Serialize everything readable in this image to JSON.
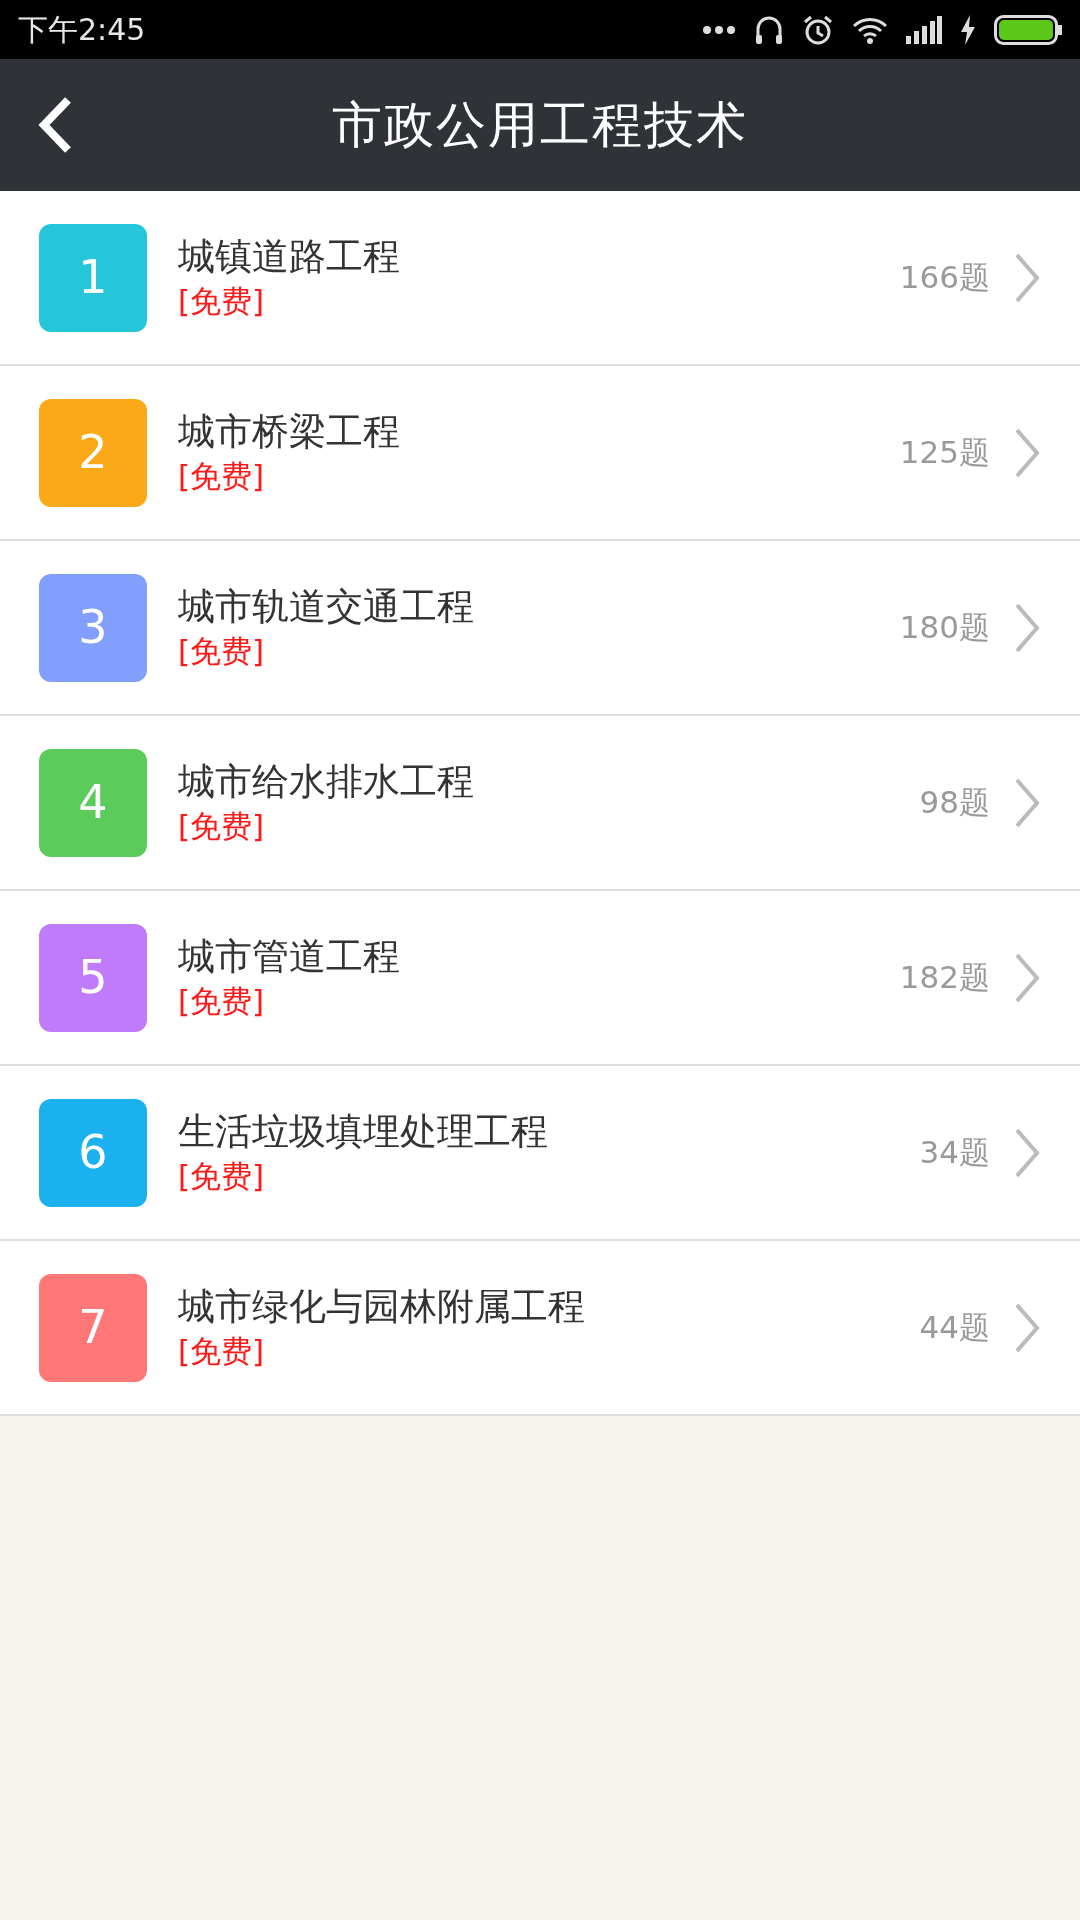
{
  "status_bar": {
    "time": "下午2:45"
  },
  "header": {
    "title": "市政公用工程技术"
  },
  "items": [
    {
      "number": "1",
      "title": "城镇道路工程",
      "tag": "[免费]",
      "count": "166题",
      "color": "#26c6da"
    },
    {
      "number": "2",
      "title": "城市桥梁工程",
      "tag": "[免费]",
      "count": "125题",
      "color": "#fba918"
    },
    {
      "number": "3",
      "title": "城市轨道交通工程",
      "tag": "[免费]",
      "count": "180题",
      "color": "#829ffd"
    },
    {
      "number": "4",
      "title": "城市给水排水工程",
      "tag": "[免费]",
      "count": "98题",
      "color": "#5bcb5b"
    },
    {
      "number": "5",
      "title": "城市管道工程",
      "tag": "[免费]",
      "count": "182题",
      "color": "#bf7bf9"
    },
    {
      "number": "6",
      "title": "生活垃圾填埋处理工程",
      "tag": "[免费]",
      "count": "34题",
      "color": "#1bb0ee"
    },
    {
      "number": "7",
      "title": "城市绿化与园林附属工程",
      "tag": "[免费]",
      "count": "44题",
      "color": "#ff7777"
    }
  ]
}
